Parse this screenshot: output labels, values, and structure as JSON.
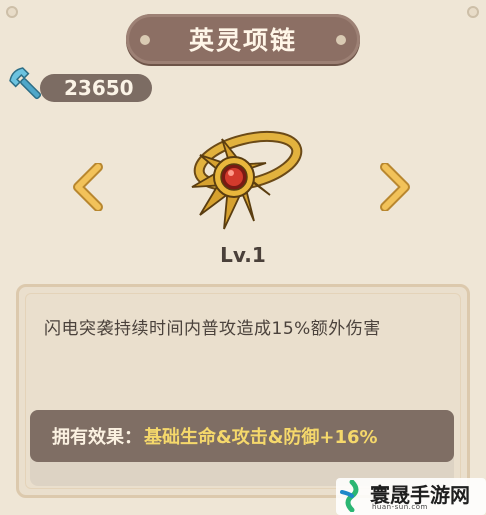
{
  "header": {
    "title": "英灵项链"
  },
  "currency": {
    "icon": "wrench-icon",
    "value": "23650"
  },
  "item": {
    "icon": "necklace-icon",
    "level": "Lv.1"
  },
  "navigation": {
    "prev_icon": "chevron-left-icon",
    "next_icon": "chevron-right-icon"
  },
  "description": {
    "text": "闪电突袭持续时间内普攻造成15%额外伤害"
  },
  "effect": {
    "label": "拥有效果：",
    "value": "基础生命&攻击&防御+16%"
  },
  "watermark": {
    "text": "寰晟手游网",
    "subtext": "huan-sun.com"
  },
  "colors": {
    "accent": "#8c6f64",
    "highlight": "#f5d86b",
    "background": "#efe6d6"
  }
}
